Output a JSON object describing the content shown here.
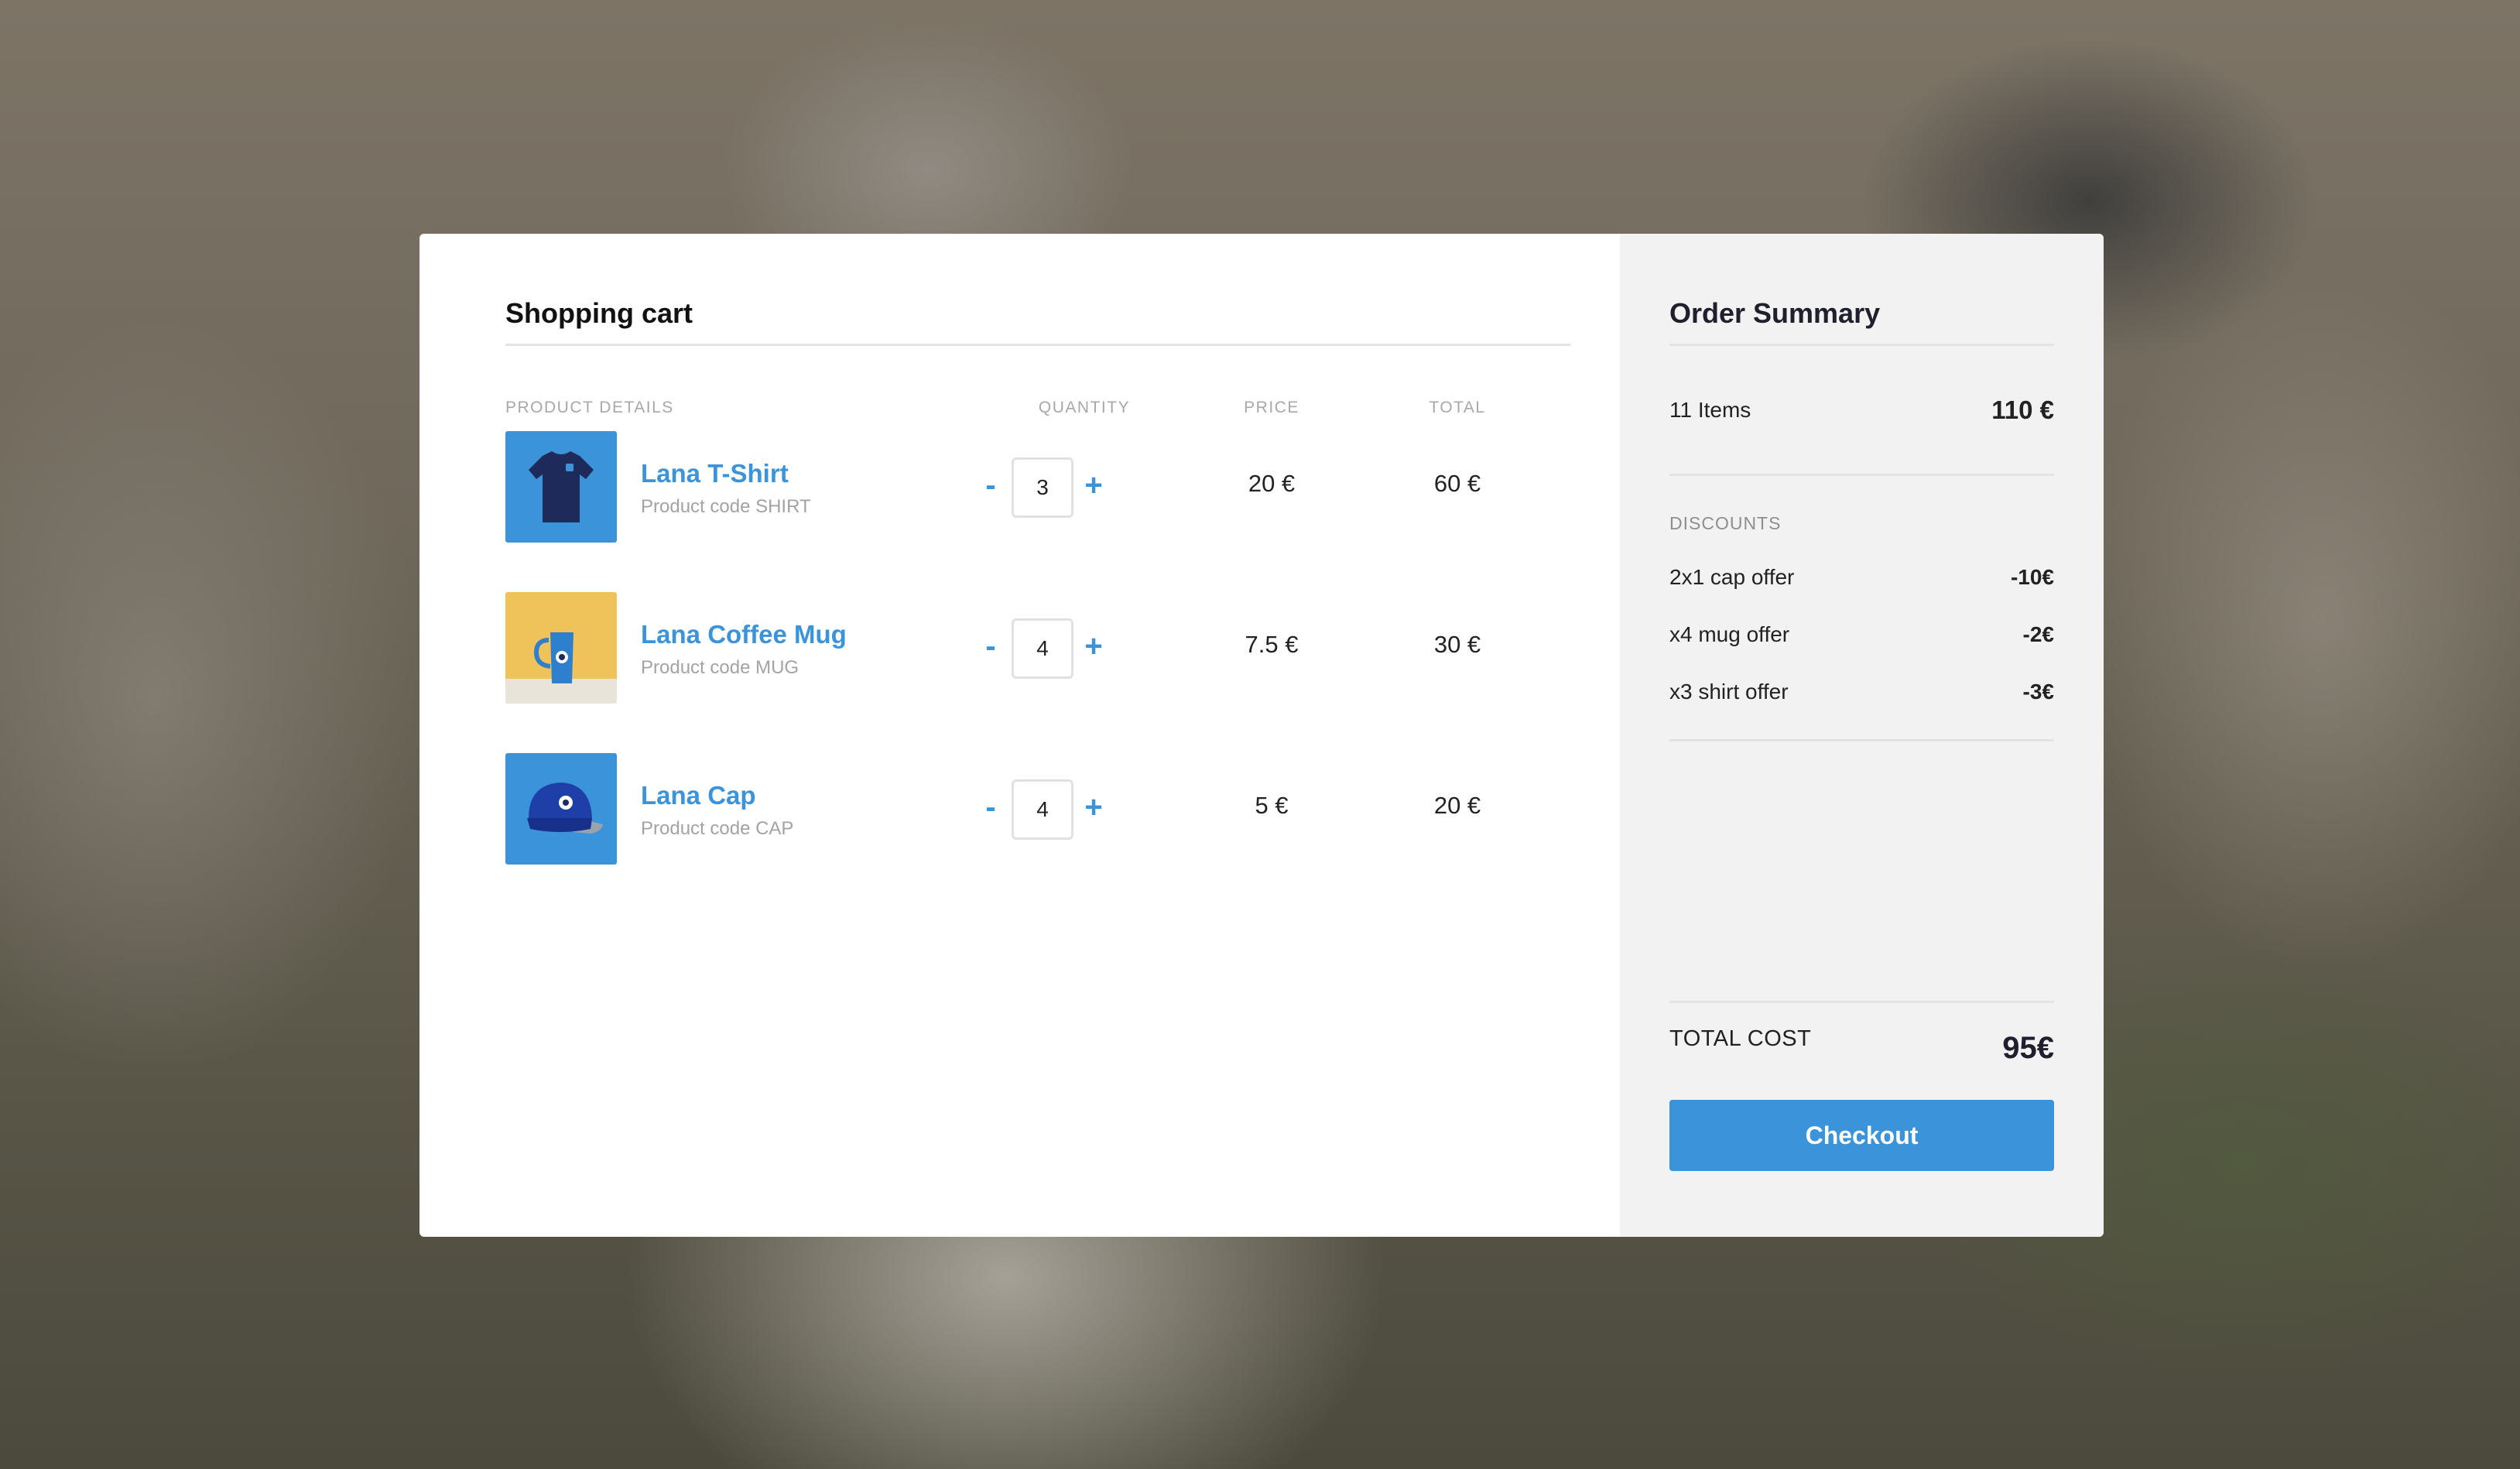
{
  "cart": {
    "title": "Shopping cart",
    "headers": {
      "product": "PRODUCT DETAILS",
      "quantity": "QUANTITY",
      "price": "PRICE",
      "total": "TOTAL"
    },
    "items": [
      {
        "name": "Lana T-Shirt",
        "code": "Product code SHIRT",
        "quantity": "3",
        "price": "20 €",
        "total": "60 €",
        "image": "t-shirt-image"
      },
      {
        "name": "Lana Coffee Mug",
        "code": "Product code MUG",
        "quantity": "4",
        "price": "7.5 €",
        "total": "30 €",
        "image": "coffee-mug-image"
      },
      {
        "name": "Lana Cap",
        "code": "Product code CAP",
        "quantity": "4",
        "price": "5 €",
        "total": "20 €",
        "image": "cap-image"
      }
    ],
    "minus_label": "-",
    "plus_label": "+"
  },
  "summary": {
    "title": "Order Summary",
    "items_count": "11 Items",
    "items_amount": "110 €",
    "discounts_label": "DISCOUNTS",
    "discounts": [
      {
        "label": "2x1 cap offer",
        "value": "-10€"
      },
      {
        "label": "x4 mug offer",
        "value": "-2€"
      },
      {
        "label": "x3 shirt offer",
        "value": "-3€"
      }
    ],
    "total_label": "TOTAL COST",
    "total_value": "95€",
    "checkout_label": "Checkout"
  },
  "colors": {
    "accent": "#3b94d9",
    "summary_bg": "#f2f2f2",
    "mug_bg": "#f0c35a"
  }
}
